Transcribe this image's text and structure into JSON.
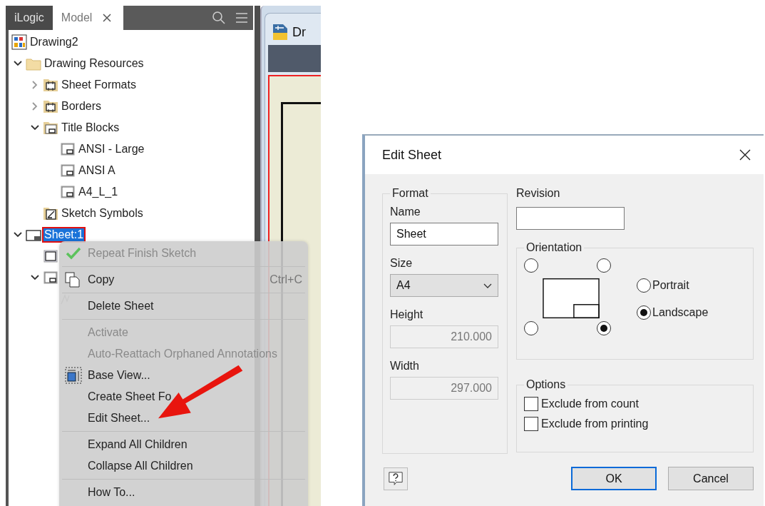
{
  "browser": {
    "tabs": [
      {
        "label": "iLogic",
        "selected": false
      },
      {
        "label": "Model",
        "selected": true,
        "closable": true
      }
    ],
    "tree": [
      {
        "label": "Drawing2",
        "kind": "drawing",
        "children": [
          {
            "label": "Drawing Resources",
            "kind": "folder",
            "expanded": true,
            "children": [
              {
                "label": "Sheet Formats",
                "kind": "resource",
                "expanded": false
              },
              {
                "label": "Borders",
                "kind": "resource",
                "expanded": false
              },
              {
                "label": "Title Blocks",
                "kind": "titleblocks",
                "expanded": true,
                "children": [
                  {
                    "label": "ANSI - Large",
                    "kind": "titleblock"
                  },
                  {
                    "label": "ANSI A",
                    "kind": "titleblock"
                  },
                  {
                    "label": "A4_L_1",
                    "kind": "titleblock"
                  }
                ]
              },
              {
                "label": "Sketch Symbols",
                "kind": "symbols"
              }
            ]
          },
          {
            "label": "Sheet:1",
            "kind": "sheet",
            "expanded": true,
            "selected": true,
            "children": [
              {
                "kind": "border"
              },
              {
                "kind": "titleblock",
                "expanded": true,
                "children": [
                  {
                    "kind": "field-text"
                  }
                ]
              }
            ]
          }
        ]
      }
    ]
  },
  "document": {
    "title": "Dr"
  },
  "context_menu": [
    {
      "kind": "check",
      "label": "Repeat Finish Sketch",
      "disabled": true
    },
    {
      "kind": "separator"
    },
    {
      "kind": "copy",
      "label": "Copy",
      "shortcut": "Ctrl+C",
      "disabled": false
    },
    {
      "kind": "separator"
    },
    {
      "kind": "plain",
      "label": "Delete Sheet",
      "disabled": false
    },
    {
      "kind": "separator"
    },
    {
      "kind": "plain",
      "label": "Activate",
      "disabled": true
    },
    {
      "kind": "plain",
      "label": "Auto-Reattach Orphaned Annotations",
      "disabled": true
    },
    {
      "kind": "base-view",
      "label": "Base View...",
      "disabled": false
    },
    {
      "kind": "plain",
      "label": "Create Sheet Fo",
      "disabled": false
    },
    {
      "kind": "plain",
      "label": "Edit Sheet...",
      "disabled": false
    },
    {
      "kind": "separator"
    },
    {
      "kind": "plain",
      "label": "Expand All Children",
      "disabled": false
    },
    {
      "kind": "plain",
      "label": "Collapse All Children",
      "disabled": false
    },
    {
      "kind": "separator"
    },
    {
      "kind": "plain",
      "label": "How To...",
      "disabled": false
    }
  ],
  "dialog": {
    "title": "Edit Sheet",
    "format": {
      "title": "Format",
      "fields": [
        {
          "kind": "text",
          "label": "Name",
          "value": "Sheet",
          "disabled": false
        },
        {
          "kind": "select",
          "label": "Size",
          "value": "A4"
        },
        {
          "kind": "text",
          "label": "Height",
          "value": "210.000",
          "disabled": true
        },
        {
          "kind": "text",
          "label": "Width",
          "value": "297.000",
          "disabled": true
        }
      ]
    },
    "revision": {
      "label": "Revision"
    },
    "orientation": {
      "title": "Orientation",
      "corners": [
        {
          "selected": false
        },
        {
          "selected": false
        },
        {
          "selected": false
        },
        {
          "selected": true
        }
      ],
      "options": [
        {
          "label": "Portrait",
          "selected": false
        },
        {
          "label": "Landscape",
          "selected": true
        }
      ]
    },
    "options": {
      "title": "Options",
      "items": [
        {
          "label": "Exclude from count",
          "checked": false
        },
        {
          "label": "Exclude from printing",
          "checked": false
        }
      ]
    },
    "buttons": [
      {
        "label": "OK",
        "default": true
      },
      {
        "label": "Cancel",
        "default": false
      }
    ]
  }
}
